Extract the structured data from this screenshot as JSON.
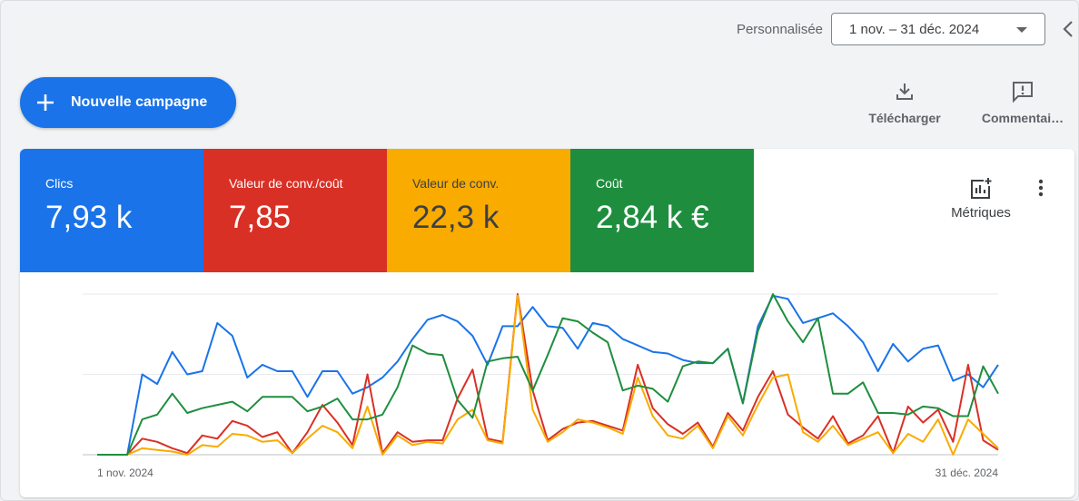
{
  "header": {
    "date_range_label": "Personnalisée",
    "date_range_value": "1 nov. – 31 déc. 2024"
  },
  "actions": {
    "new_campaign": "Nouvelle campagne",
    "download": "Télécharger",
    "comments": "Commentai…"
  },
  "scorecards": [
    {
      "label": "Clics",
      "value": "7,93 k",
      "color": "#1a73e8"
    },
    {
      "label": "Valeur de conv./coût",
      "value": "7,85",
      "color": "#d93025"
    },
    {
      "label": "Valeur de conv.",
      "value": "22,3 k",
      "color": "#f9ab00"
    },
    {
      "label": "Coût",
      "value": "2,84 k €",
      "color": "#1e8e3e"
    }
  ],
  "metrics_button": "Métriques",
  "chart_data": {
    "type": "line",
    "x_start_label": "1 nov. 2024",
    "x_end_label": "31 déc. 2024",
    "gridlines": 3,
    "y_axis_labels": "hidden",
    "ylim": [
      0,
      100
    ],
    "series": [
      {
        "name": "Clics",
        "color": "#1a73e8",
        "values": [
          0,
          0,
          0,
          50,
          44,
          64,
          50,
          52,
          82,
          74,
          48,
          56,
          52,
          52,
          36,
          52,
          52,
          38,
          42,
          48,
          58,
          72,
          84,
          87,
          83,
          74,
          56,
          80,
          80,
          92,
          80,
          79,
          66,
          82,
          80,
          72,
          68,
          64,
          63,
          59,
          57,
          57,
          66,
          32,
          80,
          99,
          97,
          82,
          85,
          88,
          80,
          70,
          52,
          69,
          58,
          66,
          68,
          46,
          50,
          42,
          56
        ]
      },
      {
        "name": "Valeur de conv./coût",
        "color": "#d93025",
        "values": [
          0,
          0,
          0,
          10,
          8,
          4,
          1,
          12,
          10,
          21,
          18,
          11,
          14,
          1,
          14,
          31,
          20,
          6,
          50,
          1,
          14,
          8,
          9,
          9,
          35,
          53,
          10,
          8,
          100,
          40,
          9,
          16,
          20,
          21,
          18,
          15,
          56,
          29,
          19,
          13,
          20,
          5,
          26,
          15,
          36,
          52,
          25,
          17,
          10,
          24,
          7,
          12,
          24,
          1,
          30,
          20,
          28,
          8,
          56,
          9,
          3
        ]
      },
      {
        "name": "Valeur de conv.",
        "color": "#f9ab00",
        "values": [
          0,
          0,
          0,
          4,
          3,
          2,
          0,
          6,
          5,
          13,
          12,
          8,
          9,
          1,
          10,
          18,
          14,
          4,
          30,
          0,
          12,
          6,
          8,
          7,
          22,
          28,
          9,
          7,
          99,
          28,
          8,
          14,
          22,
          20,
          17,
          13,
          48,
          24,
          12,
          10,
          18,
          4,
          24,
          12,
          31,
          48,
          50,
          14,
          8,
          18,
          6,
          10,
          14,
          1,
          13,
          8,
          22,
          0,
          22,
          13,
          4
        ]
      },
      {
        "name": "Coût",
        "color": "#1e8e3e",
        "values": [
          0,
          0,
          0,
          22,
          25,
          38,
          26,
          29,
          31,
          33,
          27,
          36,
          36,
          36,
          27,
          30,
          35,
          22,
          22,
          25,
          42,
          68,
          63,
          62,
          34,
          23,
          58,
          60,
          61,
          40,
          62,
          85,
          83,
          76,
          70,
          40,
          43,
          41,
          33,
          55,
          58,
          57,
          66,
          32,
          77,
          100,
          83,
          70,
          85,
          38,
          38,
          45,
          26,
          26,
          25,
          30,
          29,
          24,
          24,
          55,
          38
        ]
      }
    ]
  }
}
